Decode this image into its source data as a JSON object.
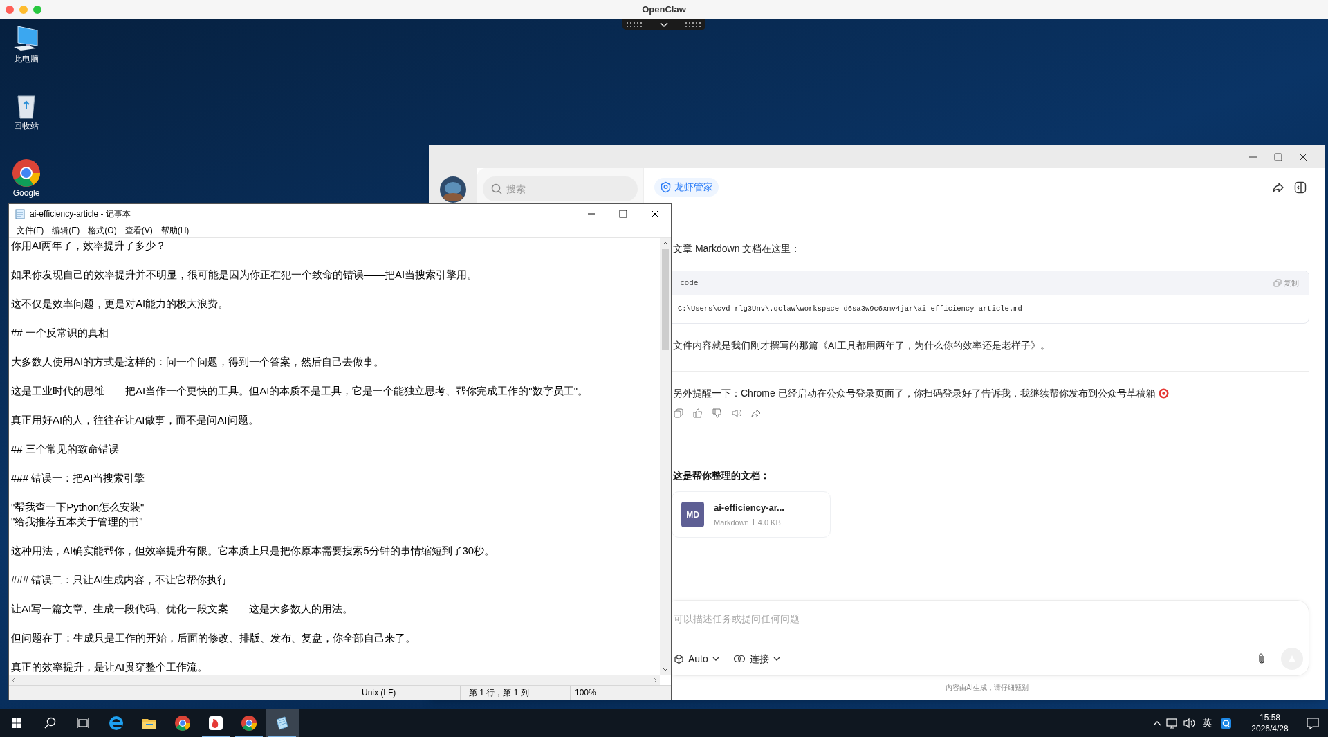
{
  "mac_window": {
    "title": "OpenClaw"
  },
  "desktop_icons": [
    {
      "kind": "computer",
      "label": "此电脑"
    },
    {
      "kind": "recycle",
      "label": "回收站"
    },
    {
      "kind": "chrome",
      "label": "Google"
    }
  ],
  "notepad": {
    "title": "ai-efficiency-article - 记事本",
    "menu": [
      "文件(F)",
      "编辑(E)",
      "格式(O)",
      "查看(V)",
      "帮助(H)"
    ],
    "paragraphs": [
      [
        "你用AI两年了，效率提升了多少？"
      ],
      [
        "如果你发现自己的效率提升并不明显，很可能是因为你正在犯一个致命的错误——把AI当搜索引擎用。"
      ],
      [
        "这不仅是效率问题，更是对AI能力的极大浪费。"
      ],
      [
        "## 一个反常识的真相"
      ],
      [
        "大多数人使用AI的方式是这样的：问一个问题，得到一个答案，然后自己去做事。"
      ],
      [
        "这是工业时代的思维——把AI当作一个更快的工具。但AI的本质不是工具，它是一个能独立思考、帮你完成工作的\"数字员工\"。"
      ],
      [
        "真正用好AI的人，往往在让AI做事，而不是问AI问题。"
      ],
      [
        "## 三个常见的致命错误"
      ],
      [
        "### 错误一：把AI当搜索引擎"
      ],
      [
        "\"帮我查一下Python怎么安装\"",
        "\"给我推荐五本关于管理的书\""
      ],
      [
        "这种用法，AI确实能帮你，但效率提升有限。它本质上只是把你原本需要搜索5分钟的事情缩短到了30秒。"
      ],
      [
        "### 错误二：只让AI生成内容，不让它帮你执行"
      ],
      [
        "让AI写一篇文章、生成一段代码、优化一段文案——这是大多数人的用法。"
      ],
      [
        "但问题在于：生成只是工作的开始，后面的修改、排版、发布、复盘，你全部自己来了。"
      ],
      [
        "真正的效率提升，是让AI贯穿整个工作流。"
      ]
    ],
    "status": [
      "Unix (LF)",
      "第 1 行，第 1 列",
      "100%"
    ]
  },
  "chat": {
    "search": {
      "placeholder": "搜索"
    },
    "agent_chip": "龙虾管家",
    "messages": [
      {
        "kind": "text",
        "text": "文章 Markdown 文档在这里："
      },
      {
        "kind": "code",
        "label": "code",
        "copy": "复制",
        "code": "C:\\Users\\cvd-rlg3Unv\\.qclaw\\workspace-d6sa3w9c6xmv4jar\\ai-efficiency-article.md"
      },
      {
        "kind": "text",
        "text": "文件内容就是我们刚才撰写的那篇《AI工具都用两年了，为什么你的效率还是老样子》。"
      },
      {
        "kind": "divider"
      },
      {
        "kind": "text",
        "text": "另外提醒一下：Chrome 已经启动在公众号登录页面了，你扫码登录好了告诉我，我继续帮你发布到公众号草稿箱"
      },
      {
        "kind": "actions"
      },
      {
        "kind": "heading",
        "text": "这是帮你整理的文档："
      },
      {
        "kind": "file",
        "badge": "MD",
        "name": "ai-efficiency-ar...",
        "type": "Markdown",
        "size": "4.0 KB"
      }
    ],
    "input": {
      "placeholder": "可以描述任务或提问任何问题",
      "model": "Auto",
      "connect": "连接"
    },
    "footer": "内容由AI生成，请仔细甄别"
  },
  "taskbar": {
    "apps": [
      {
        "kind": "ie",
        "running": false,
        "selected": false
      },
      {
        "kind": "explorer",
        "running": false,
        "selected": false
      },
      {
        "kind": "chrome",
        "running": false,
        "selected": false
      },
      {
        "kind": "redapp",
        "running": true,
        "selected": false
      },
      {
        "kind": "chrome",
        "running": true,
        "selected": false
      },
      {
        "kind": "notepad",
        "running": true,
        "selected": true
      }
    ],
    "ime": "英",
    "clock": {
      "time": "15:58",
      "date": "2026/4/28"
    }
  }
}
